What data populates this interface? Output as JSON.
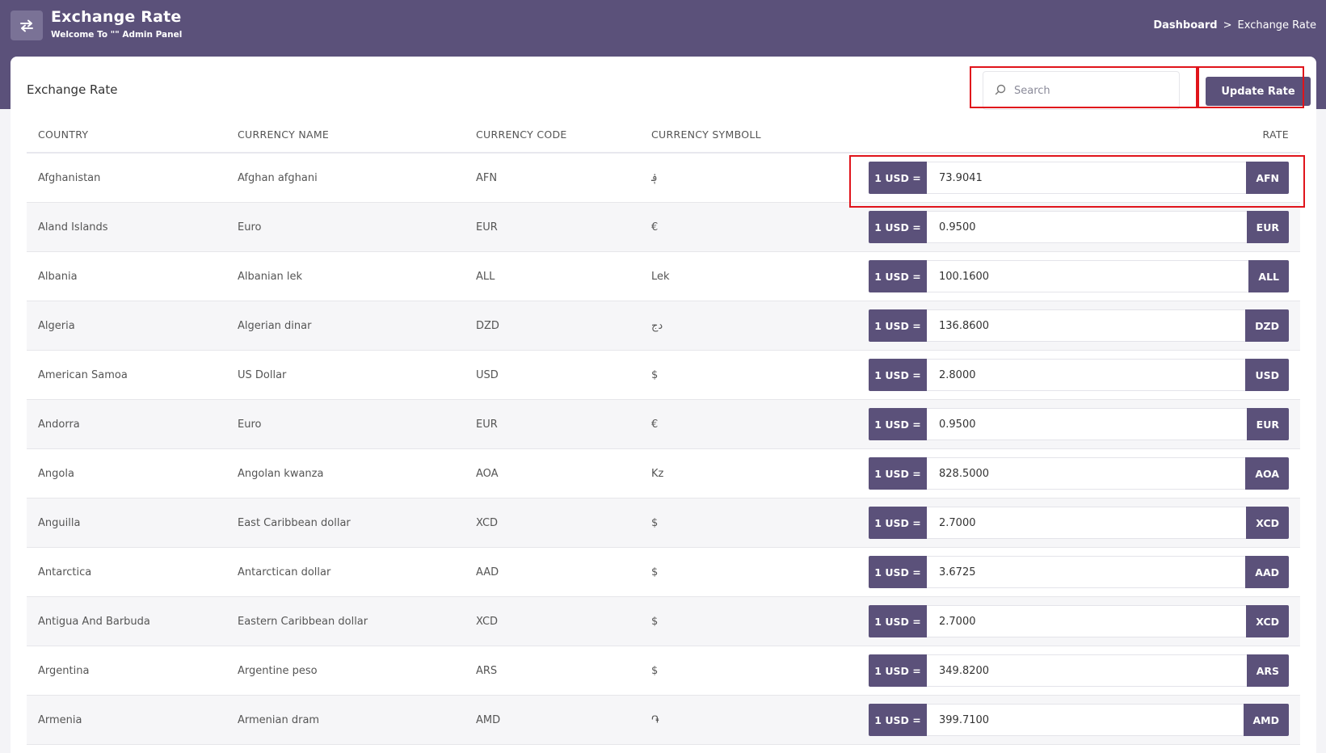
{
  "header": {
    "app_icon": "exchange-arrows-icon",
    "title": "Exchange Rate",
    "subtitle": "Welcome To \"\" Admin Panel",
    "breadcrumb": {
      "home": "Dashboard",
      "separator": ">",
      "current": "Exchange Rate"
    }
  },
  "card": {
    "title": "Exchange Rate",
    "search_placeholder": "Search",
    "update_button": "Update Rate"
  },
  "table": {
    "headers": {
      "country": "COUNTRY",
      "currency_name": "CURRENCY NAME",
      "currency_code": "CURRENCY CODE",
      "currency_symbol": "CURRENCY SYMBOLL",
      "rate": "RATE"
    },
    "rate_prefix": "1 USD =",
    "rows": [
      {
        "country": "Afghanistan",
        "name": "Afghan afghani",
        "code": "AFN",
        "symbol": "؋",
        "rate": "73.9041"
      },
      {
        "country": "Aland Islands",
        "name": "Euro",
        "code": "EUR",
        "symbol": "€",
        "rate": "0.9500"
      },
      {
        "country": "Albania",
        "name": "Albanian lek",
        "code": "ALL",
        "symbol": "Lek",
        "rate": "100.1600"
      },
      {
        "country": "Algeria",
        "name": "Algerian dinar",
        "code": "DZD",
        "symbol": "دج",
        "rate": "136.8600"
      },
      {
        "country": "American Samoa",
        "name": "US Dollar",
        "code": "USD",
        "symbol": "$",
        "rate": "2.8000"
      },
      {
        "country": "Andorra",
        "name": "Euro",
        "code": "EUR",
        "symbol": "€",
        "rate": "0.9500"
      },
      {
        "country": "Angola",
        "name": "Angolan kwanza",
        "code": "AOA",
        "symbol": "Kz",
        "rate": "828.5000"
      },
      {
        "country": "Anguilla",
        "name": "East Caribbean dollar",
        "code": "XCD",
        "symbol": "$",
        "rate": "2.7000"
      },
      {
        "country": "Antarctica",
        "name": "Antarctican dollar",
        "code": "AAD",
        "symbol": "$",
        "rate": "3.6725"
      },
      {
        "country": "Antigua And Barbuda",
        "name": "Eastern Caribbean dollar",
        "code": "XCD",
        "symbol": "$",
        "rate": "2.7000"
      },
      {
        "country": "Argentina",
        "name": "Argentine peso",
        "code": "ARS",
        "symbol": "$",
        "rate": "349.8200"
      },
      {
        "country": "Armenia",
        "name": "Armenian dram",
        "code": "AMD",
        "symbol": "֏",
        "rate": "399.7100"
      }
    ]
  },
  "colors": {
    "header_bg": "#5b517a",
    "accent": "#5b517a",
    "highlight": "#e0141b"
  }
}
